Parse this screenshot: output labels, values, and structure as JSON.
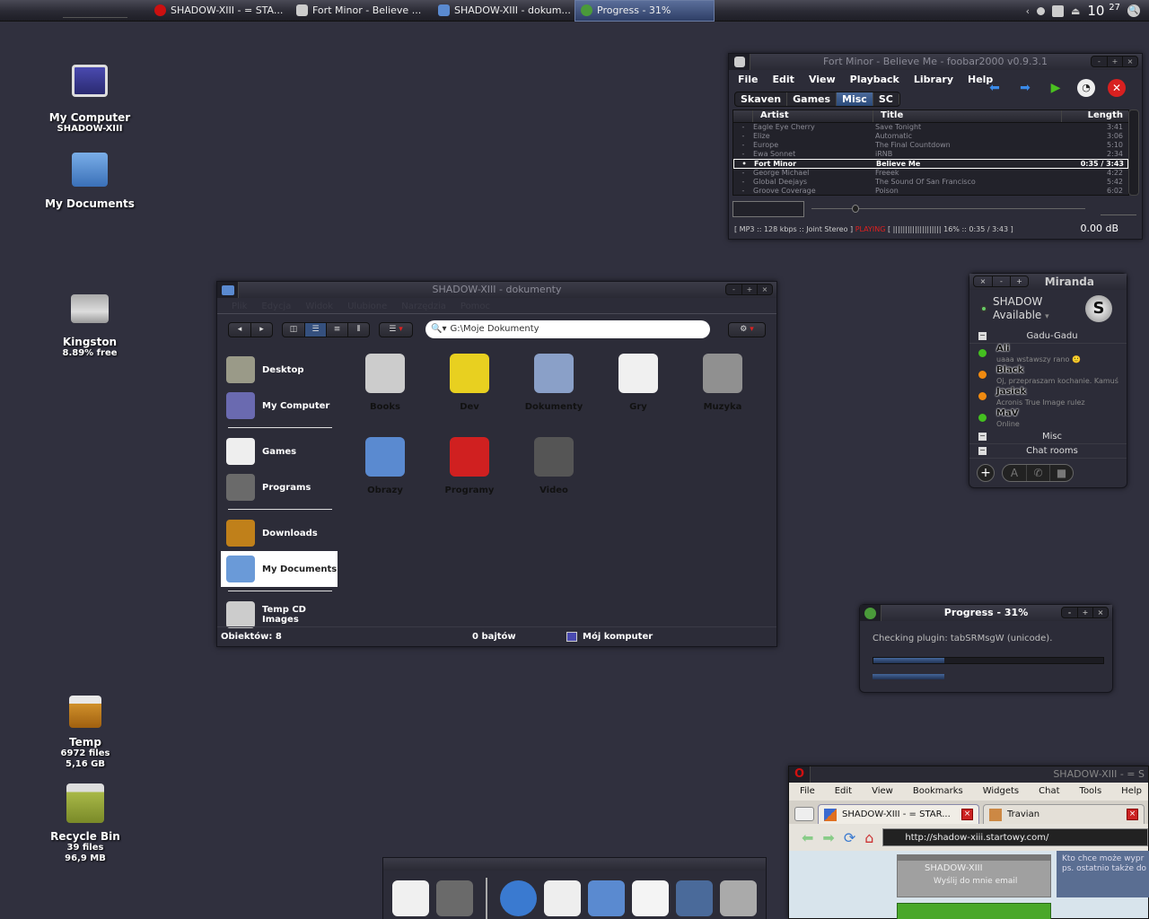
{
  "taskbar": {
    "apple_icon": "apple-icon",
    "tasks": [
      {
        "label": "SHADOW-XIII - = STA...",
        "icon": "opera-icon",
        "color": "#cc1010"
      },
      {
        "label": "Fort Minor - Believe ...",
        "icon": "alien-icon",
        "color": "#cccccc"
      },
      {
        "label": "SHADOW-XIII - dokum...",
        "icon": "folder-icon",
        "color": "#5a8ad0"
      },
      {
        "label": "Progress - 31%",
        "icon": "download-icon",
        "color": "#4a9a3a",
        "active": true
      }
    ],
    "tray_arrow": "‹",
    "clock_hour": "10",
    "clock_min": "27"
  },
  "desktop": {
    "icons": [
      {
        "title": "My Computer",
        "sub1": "SHADOW-XIII",
        "sub2": ""
      },
      {
        "title": "My Documents",
        "sub1": "",
        "sub2": ""
      },
      {
        "title": "Kingston",
        "sub1": "8.89% free",
        "sub2": ""
      },
      {
        "title": "Temp",
        "sub1": "6972 files",
        "sub2": "5,16 GB"
      },
      {
        "title": "Recycle Bin",
        "sub1": "39 files",
        "sub2": "96,9 MB"
      }
    ]
  },
  "foobar": {
    "title": "Fort Minor - Believe Me - foobar2000 v0.9.3.1",
    "menu": [
      "File",
      "Edit",
      "View",
      "Playback",
      "Library",
      "Help"
    ],
    "tabs": [
      "Skaven",
      "Games",
      "Misc",
      "SC"
    ],
    "selected_tab": "Misc",
    "columns": [
      "Artist",
      "Title",
      "Length"
    ],
    "rows": [
      {
        "marker": "-",
        "artist": "Eagle Eye Cherry",
        "title": "Save Tonight",
        "length": "3:41"
      },
      {
        "marker": "-",
        "artist": "Elize",
        "title": "Automatic",
        "length": "3:06"
      },
      {
        "marker": "-",
        "artist": "Europe",
        "title": "The Final Countdown",
        "length": "5:10"
      },
      {
        "marker": "-",
        "artist": "Ewa Sonnet",
        "title": "iRNB",
        "length": "2:34"
      },
      {
        "marker": "•",
        "artist": "Fort Minor",
        "title": "Believe Me",
        "length": "0:35 / 3:43",
        "current": true
      },
      {
        "marker": "-",
        "artist": "George Michael",
        "title": "Freeek",
        "length": "4:22"
      },
      {
        "marker": "-",
        "artist": "Global Deejays",
        "title": "The Sound Of San Francisco",
        "length": "5:42"
      },
      {
        "marker": "-",
        "artist": "Groove Coverage",
        "title": "Poison",
        "length": "6:02"
      }
    ],
    "status_format": "[ MP3 :: 128 kbps :: Joint Stereo ]",
    "status_state": "PLAYING",
    "status_progress": "[ |||||||||||||||||||| 16% :: 0:35 / 3:43 ]",
    "seek_fraction": 0.16,
    "volume": "0.00 dB"
  },
  "explorer": {
    "title": "SHADOW-XIII - dokumenty",
    "menu": [
      "Plik",
      "Edycja",
      "Widok",
      "Ulubione",
      "Narzędzia",
      "Pomoc"
    ],
    "address": "G:\\Moje Dokumenty",
    "sidebar": [
      {
        "label": "Desktop",
        "color": "#9a9a88"
      },
      {
        "label": "My Computer",
        "color": "#6a6ab0",
        "sep_after": true
      },
      {
        "label": "Games",
        "color": "#eeeeee"
      },
      {
        "label": "Programs",
        "color": "#6a6a6a",
        "sep_after": true
      },
      {
        "label": "Downloads",
        "color": "#c0801a"
      },
      {
        "label": "My Documents",
        "color": "#6a9ad8",
        "selected": true,
        "sep_after": true
      },
      {
        "label": "Temp CD Images",
        "color": "#cccccc"
      }
    ],
    "items": [
      {
        "label": "Books",
        "color": "#cccccc"
      },
      {
        "label": "Dev",
        "color": "#e8d020"
      },
      {
        "label": "Dokumenty",
        "color": "#8aa0c8"
      },
      {
        "label": "Gry",
        "color": "#f0f0f0"
      },
      {
        "label": "Muzyka",
        "color": "#909090"
      },
      {
        "label": "Obrazy",
        "color": "#5a8ad0"
      },
      {
        "label": "Programy",
        "color": "#d02020"
      },
      {
        "label": "Video",
        "color": "#555555"
      }
    ],
    "status_count": "Obiektów: 8",
    "status_size": "0 bajtów",
    "status_location": "Mój komputer"
  },
  "miranda": {
    "title": "Miranda",
    "user": "SHADOW",
    "status": "Available",
    "groups": [
      {
        "name": "Gadu-Gadu",
        "contacts": [
          {
            "name": "Ali",
            "message": "uaaa wstawszy rano 🙂",
            "status_color": "#44c020"
          },
          {
            "name": "Black",
            "message": "Oj, przepraszam kochanie. Kamuś",
            "status_color": "#f08a10"
          },
          {
            "name": "Jasiek",
            "message": "Acronis True Image rulez",
            "status_color": "#f08a10"
          },
          {
            "name": "MaV",
            "message": "Online",
            "status_color": "#44c020"
          }
        ]
      },
      {
        "name": "Misc",
        "contacts": []
      },
      {
        "name": "Chat rooms",
        "contacts": []
      }
    ]
  },
  "progress": {
    "title": "Progress - 31%",
    "message": "Checking plugin: tabSRMsgW (unicode).",
    "fraction": 0.31
  },
  "opera": {
    "title": "SHADOW-XIII - = S",
    "menu": [
      "File",
      "Edit",
      "View",
      "Bookmarks",
      "Widgets",
      "Chat",
      "Tools",
      "Help"
    ],
    "tabs": [
      {
        "label": "SHADOW-XIII - = STAR...",
        "selected": true
      },
      {
        "label": "Travian",
        "selected": false
      }
    ],
    "url": "http://shadow-xiii.startowy.com/",
    "page_box_title": "SHADOW-XIII",
    "page_box_link": "Wyślij do mnie email",
    "page_side_text1": "Kto chce może wypr",
    "page_side_text2": "ps. ostatnio także do"
  },
  "dock": {
    "items": [
      {
        "name": "games",
        "color": "#f0f0f0"
      },
      {
        "name": "calculator",
        "color": "#6a6a6a"
      },
      {
        "name": "browser",
        "color": "#3a7ad0"
      },
      {
        "name": "mail",
        "color": "#eeeeee"
      },
      {
        "name": "paint",
        "color": "#5a8ad0"
      },
      {
        "name": "chat",
        "color": "#f4f4f4"
      },
      {
        "name": "image-viewer",
        "color": "#4a6a9a"
      },
      {
        "name": "audio",
        "color": "#aaaaaa"
      }
    ]
  }
}
